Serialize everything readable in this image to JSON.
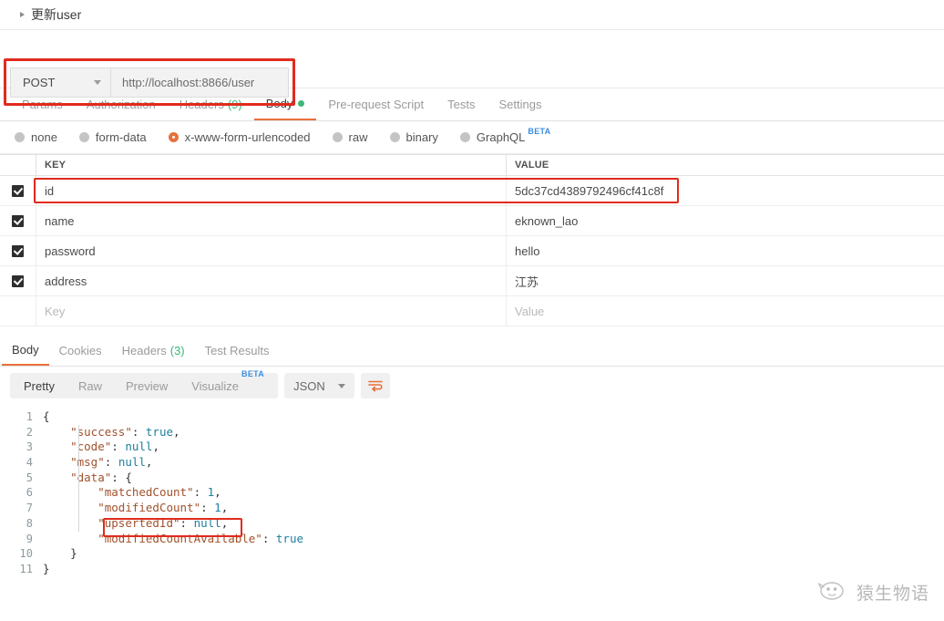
{
  "title": {
    "text": "更新user",
    "caret_icon": "triangle-right-icon"
  },
  "request": {
    "method": "POST",
    "url": "http://localhost:8866/user",
    "highlight_color": "#e02b1d",
    "tabs": [
      {
        "label": "Params",
        "active": false
      },
      {
        "label": "Authorization",
        "active": false
      },
      {
        "label": "Headers",
        "count": "(9)",
        "active": false
      },
      {
        "label": "Body",
        "active": true,
        "dot": true
      },
      {
        "label": "Pre-request Script",
        "active": false
      },
      {
        "label": "Tests",
        "active": false
      },
      {
        "label": "Settings",
        "active": false
      }
    ],
    "body_types": [
      {
        "label": "none",
        "selected": false
      },
      {
        "label": "form-data",
        "selected": false
      },
      {
        "label": "x-www-form-urlencoded",
        "selected": true
      },
      {
        "label": "raw",
        "selected": false
      },
      {
        "label": "binary",
        "selected": false
      },
      {
        "label": "GraphQL",
        "selected": false,
        "badge": "BETA"
      }
    ],
    "table": {
      "columns": [
        "KEY",
        "VALUE"
      ],
      "rows": [
        {
          "checked": true,
          "key": "id",
          "value": "5dc37cd4389792496cf41c8f",
          "highlighted": true
        },
        {
          "checked": true,
          "key": "name",
          "value": "eknown_lao",
          "highlighted": false
        },
        {
          "checked": true,
          "key": "password",
          "value": "hello",
          "highlighted": false
        },
        {
          "checked": true,
          "key": "address",
          "value": "江苏",
          "highlighted": false
        }
      ],
      "placeholder_row": {
        "key": "Key",
        "value": "Value"
      }
    }
  },
  "response": {
    "tabs": [
      {
        "label": "Body",
        "active": true
      },
      {
        "label": "Cookies",
        "active": false
      },
      {
        "label": "Headers",
        "count": "(3)",
        "active": false
      },
      {
        "label": "Test Results",
        "active": false
      }
    ],
    "view_modes": [
      {
        "label": "Pretty",
        "active": true
      },
      {
        "label": "Raw",
        "active": false
      },
      {
        "label": "Preview",
        "active": false
      },
      {
        "label": "Visualize",
        "active": false,
        "badge": "BETA"
      }
    ],
    "format": "JSON",
    "wrap_icon": "word-wrap-icon",
    "code_lines": [
      {
        "n": "1",
        "text": "{"
      },
      {
        "n": "2",
        "text": "    \"success\": true,"
      },
      {
        "n": "3",
        "text": "    \"code\": null,"
      },
      {
        "n": "4",
        "text": "    \"msg\": null,"
      },
      {
        "n": "5",
        "text": "    \"data\": {"
      },
      {
        "n": "6",
        "text": "        \"matchedCount\": 1,"
      },
      {
        "n": "7",
        "text": "        \"modifiedCount\": 1,"
      },
      {
        "n": "8",
        "text": "        \"upsertedId\": null,"
      },
      {
        "n": "9",
        "text": "        \"modifiedCountAvailable\": true"
      },
      {
        "n": "10",
        "text": "    }"
      },
      {
        "n": "11",
        "text": "}"
      }
    ],
    "highlighted_line": "\"modifiedCount\": 1,"
  },
  "watermark": {
    "text": "猿生物语",
    "icon": "wechat-whale-icon"
  },
  "colors": {
    "accent": "#e8703a",
    "success": "#3cb878",
    "highlight": "#e02b1d",
    "beta": "#3c8ede"
  }
}
